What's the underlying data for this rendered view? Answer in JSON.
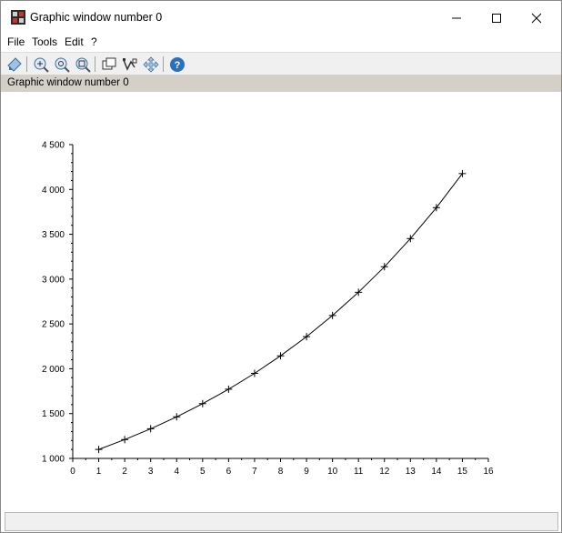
{
  "window": {
    "title": "Graphic window number 0"
  },
  "menubar": {
    "items": [
      "File",
      "Tools",
      "Edit",
      "?"
    ]
  },
  "toolbar": {
    "icons": [
      "select-icon",
      "zoom-in-icon",
      "zoom-out-icon",
      "zoom-reset-icon",
      "rotate-icon",
      "datatip-icon",
      "pan-icon",
      "help-icon"
    ]
  },
  "infobar": {
    "text": "Graphic window number 0"
  },
  "status": {
    "text": ""
  },
  "chart_data": {
    "type": "line",
    "marker": "plus",
    "x": [
      1,
      2,
      3,
      4,
      5,
      6,
      7,
      8,
      9,
      10,
      11,
      12,
      13,
      14,
      15
    ],
    "y": [
      1100,
      1210,
      1331,
      1464,
      1611,
      1772,
      1949,
      2144,
      2358,
      2594,
      2853,
      3138,
      3452,
      3797,
      4177
    ],
    "xlim": [
      0,
      16
    ],
    "ylim": [
      1000,
      4500
    ],
    "xticks": [
      0,
      1,
      2,
      3,
      4,
      5,
      6,
      7,
      8,
      9,
      10,
      11,
      12,
      13,
      14,
      15,
      16
    ],
    "yticks": [
      1000,
      1500,
      2000,
      2500,
      3000,
      3500,
      4000,
      4500
    ],
    "ytick_labels": [
      "1 000",
      "1 500",
      "2 000",
      "2 500",
      "3 000",
      "3 500",
      "4 000",
      "4 500"
    ],
    "title": "",
    "xlabel": "",
    "ylabel": "",
    "line_color": "#000000"
  }
}
